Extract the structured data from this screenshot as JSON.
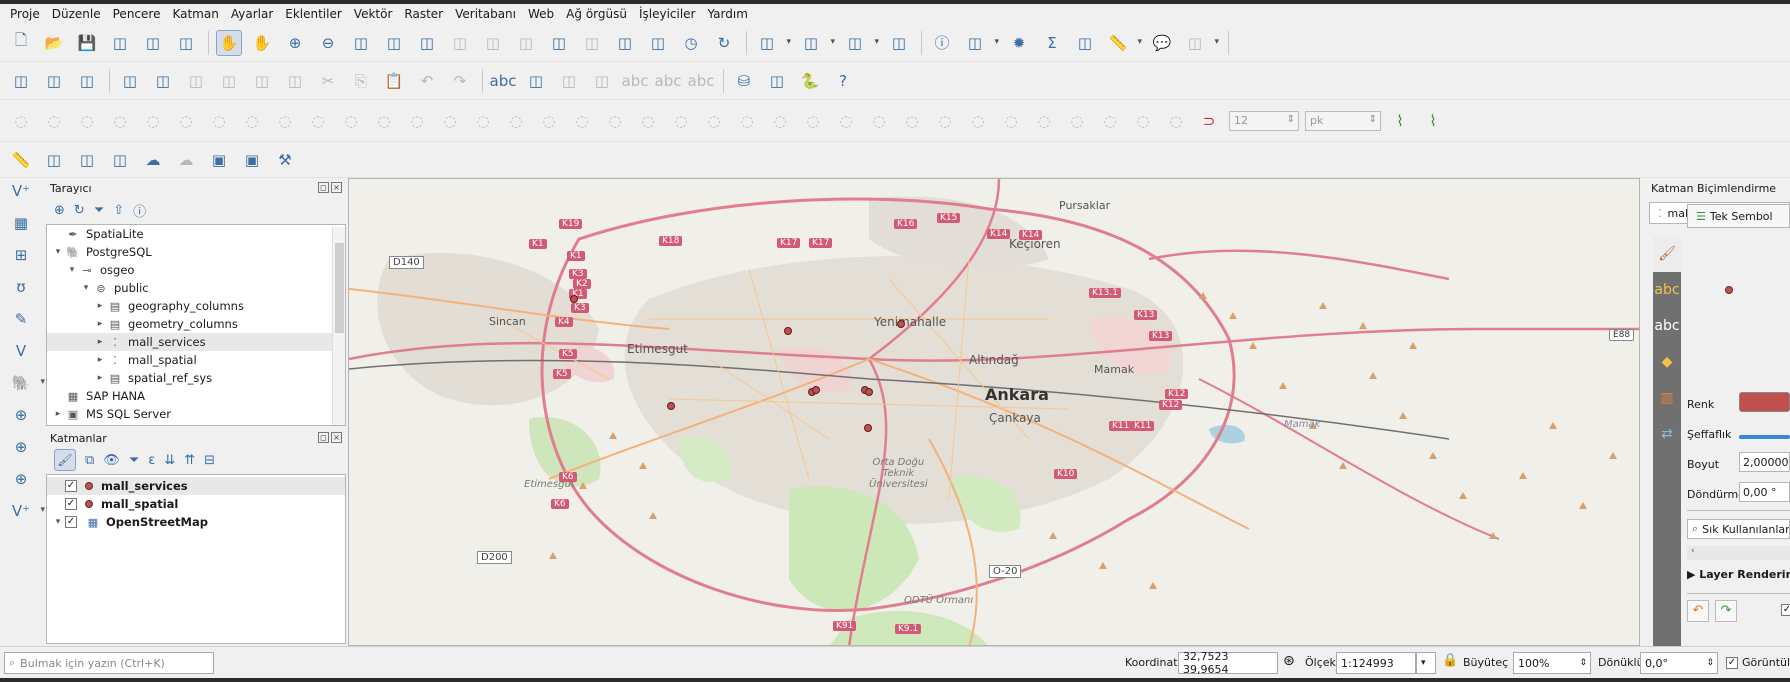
{
  "menu": [
    "Proje",
    "Düzenle",
    "Pencere",
    "Katman",
    "Ayarlar",
    "Eklentiler",
    "Vektör",
    "Raster",
    "Veritabanı",
    "Web",
    "Ağ örgüsü",
    "İşleyiciler",
    "Yardım"
  ],
  "toolbar_icons": {
    "row1": [
      "new-project-icon",
      "open-project-icon",
      "save-project-icon",
      "save-as-icon",
      "print-layout-icon",
      "style-manager-icon",
      "pan-icon",
      "pan-to-selection-icon",
      "zoom-in-icon",
      "zoom-out-icon",
      "zoom-full-icon",
      "zoom-to-selection-icon",
      "zoom-to-layer-icon",
      "zoom-native-icon",
      "zoom-last-icon",
      "zoom-next-icon",
      "new-map-view-icon",
      "new-3d-map-icon",
      "new-bookmark-icon",
      "show-bookmarks-icon",
      "temporal-controller-icon",
      "refresh-icon",
      "select-features-icon",
      "select-by-value-icon",
      "deselect-icon",
      "select-location-icon",
      "identify-icon",
      "attribute-table-icon",
      "settings-icon",
      "statistics-icon",
      "field-calculator-icon",
      "measure-icon",
      "map-tips-icon",
      "text-annotation-icon"
    ],
    "row2": [
      "data-source-manager-icon",
      "new-geopackage-icon",
      "new-shapefile-icon",
      "digitize-icon",
      "toggle-editing-icon",
      "save-edits-icon",
      "add-feature-icon",
      "vertex-tool-icon",
      "delete-icon",
      "cut-icon",
      "copy-icon",
      "paste-icon",
      "undo-icon",
      "redo-icon",
      "label-icon",
      "diagram-icon",
      "pin-label-icon",
      "show-hide-label-icon",
      "label-move-icon",
      "label-rotate-icon",
      "label-change-icon",
      "db-manager-icon",
      "qgis-browser-icon",
      "python-console-icon",
      "help-icon"
    ],
    "row3": [
      "snapping-icon",
      "snapping-type-icon",
      "tracing-icon",
      "self-snapping-icon"
    ],
    "row4": [
      "measure-line-icon",
      "select-poly-icon",
      "feature-form-icon",
      "add-layer-icon",
      "cloud-icon",
      "cloud-upload-icon",
      "box-icon",
      "box-green-icon",
      "hammer-icon"
    ]
  },
  "snap": {
    "tolerance": "12",
    "unit": "pk"
  },
  "browser": {
    "title": "Tarayıcı",
    "items": [
      {
        "label": "SpatiaLite",
        "indent": 0,
        "expanded": null,
        "icon": "feather-icon"
      },
      {
        "label": "PostgreSQL",
        "indent": 0,
        "expanded": true,
        "icon": "elephant-icon"
      },
      {
        "label": "osgeo",
        "indent": 1,
        "expanded": true,
        "icon": "connection-icon"
      },
      {
        "label": "public",
        "indent": 2,
        "expanded": true,
        "icon": "schema-icon"
      },
      {
        "label": "geography_columns",
        "indent": 3,
        "expanded": false,
        "icon": "table-icon"
      },
      {
        "label": "geometry_columns",
        "indent": 3,
        "expanded": false,
        "icon": "table-icon"
      },
      {
        "label": "mall_services",
        "indent": 3,
        "expanded": false,
        "icon": "point-layer-icon",
        "selected": true
      },
      {
        "label": "mall_spatial",
        "indent": 3,
        "expanded": false,
        "icon": "point-layer-icon"
      },
      {
        "label": "spatial_ref_sys",
        "indent": 3,
        "expanded": false,
        "icon": "table-icon"
      },
      {
        "label": "SAP HANA",
        "indent": 0,
        "expanded": null,
        "icon": "hana-icon"
      },
      {
        "label": "MS SQL Server",
        "indent": 0,
        "expanded": false,
        "icon": "mssql-icon"
      }
    ]
  },
  "layers": {
    "title": "Katmanlar",
    "items": [
      {
        "label": "mall_services",
        "type": "point",
        "checked": true,
        "selected": true
      },
      {
        "label": "mall_spatial",
        "type": "point",
        "checked": true
      },
      {
        "label": "OpenStreetMap",
        "type": "raster",
        "checked": true,
        "expanded": true
      }
    ]
  },
  "map": {
    "places": [
      "Pursaklar",
      "Keçiören",
      "Yenimahalle",
      "Sincan",
      "Etimesgut",
      "Altındağ",
      "Mamak",
      "Ankara",
      "Çankaya",
      "Orta Doğu\nTeknik\nÜniversitesi",
      "Etimesgut",
      "Mamak",
      "ODTÜ Ormanı"
    ],
    "roads": [
      "K19",
      "K1",
      "K1",
      "K3",
      "K2",
      "K1",
      "K3",
      "K4",
      "K5",
      "K5",
      "K18",
      "K17",
      "K17",
      "K16",
      "K15",
      "K14",
      "K14",
      "K13.1",
      "K13",
      "K13",
      "K12",
      "K12",
      "K11",
      "K11",
      "K10",
      "K6",
      "K6",
      "K91",
      "K9.1",
      "E88"
    ],
    "route_labels": [
      "D140",
      "D200",
      "O-20"
    ]
  },
  "styling": {
    "title": "Katman Biçimlendirme",
    "layer": "mall_services",
    "renderer": "Tek Sembol",
    "color_label": "Renk",
    "color": "#c0504d",
    "opacity_label": "Şeffaflık",
    "size_label": "Boyut",
    "size_value": "2,00000",
    "rotation_label": "Döndürme",
    "rotation_value": "0,00 °",
    "favorites": "Sık Kullanılanlar",
    "layer_rendering": "Layer Rendering"
  },
  "status": {
    "search_placeholder": "Bulmak için yazın (Ctrl+K)",
    "coord_label": "Koordinat",
    "coord_value": "32,7523 39,9654",
    "scale_label": "Ölçek",
    "scale_value": "1:124993",
    "magnifier_label": "Büyüteç",
    "magnifier_value": "100%",
    "rotation_label": "Dönüklük",
    "rotation_value": "0,0°",
    "render_label": "Görüntüle"
  }
}
